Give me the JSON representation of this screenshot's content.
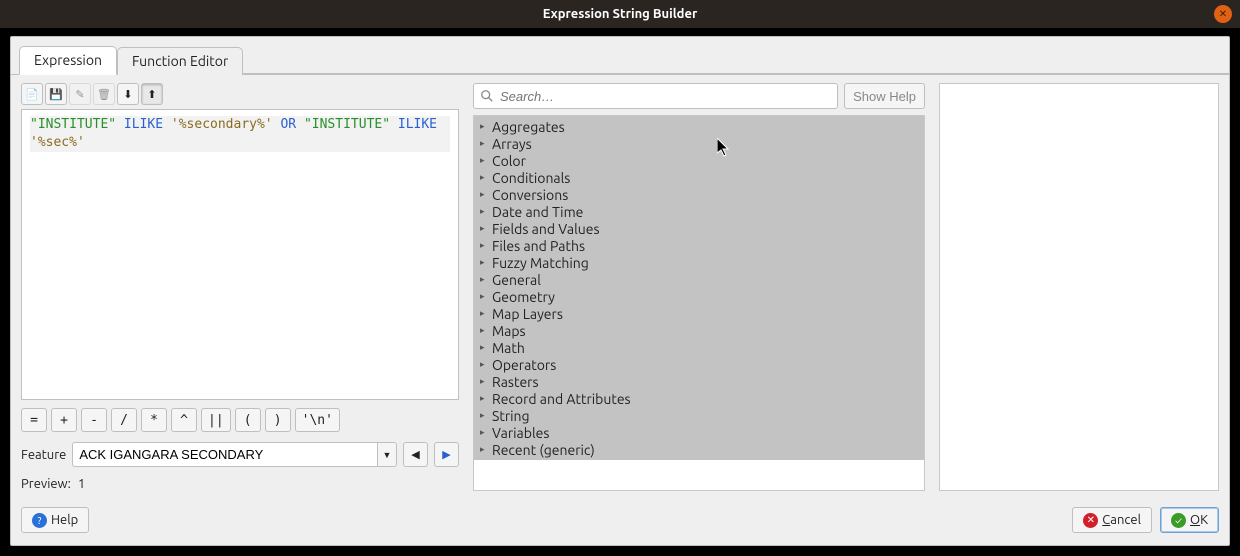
{
  "window": {
    "title": "Expression String Builder"
  },
  "tabs": {
    "expression": "Expression",
    "function_editor": "Function Editor"
  },
  "toolbar_icons": {
    "new": "📄",
    "save": "💾",
    "edit": "✎",
    "delete": "🗑",
    "import": "⬇",
    "export": "⬆"
  },
  "expression": {
    "tokens": {
      "field1": "\"INSTITUTE\"",
      "sp1": " ",
      "kw1": "ILIKE",
      "sp2": " ",
      "lit1": "'%secondary%'",
      "sp3": " ",
      "kw2": "OR",
      "sp4": " ",
      "field2": "\"INSTITUTE\"",
      "sp5": " ",
      "kw3": "ILIKE",
      "nl": "\n",
      "lit2": "'%sec%'"
    }
  },
  "operators": {
    "eq": "=",
    "plus": "+",
    "minus": "-",
    "div": "/",
    "mul": "*",
    "pow": "^",
    "concat": "||",
    "lparen": "(",
    "rparen": ")",
    "newline": "'\\n'"
  },
  "feature": {
    "label": "Feature",
    "value": "ACK IGANGARA SECONDARY"
  },
  "preview": {
    "label": "Preview:",
    "value": "1"
  },
  "search": {
    "placeholder": "Search…"
  },
  "buttons": {
    "show_help": "Show Help",
    "help": "Help",
    "cancel": "Cancel",
    "ok": "OK"
  },
  "categories": [
    "Aggregates",
    "Arrays",
    "Color",
    "Conditionals",
    "Conversions",
    "Date and Time",
    "Fields and Values",
    "Files and Paths",
    "Fuzzy Matching",
    "General",
    "Geometry",
    "Map Layers",
    "Maps",
    "Math",
    "Operators",
    "Rasters",
    "Record and Attributes",
    "String",
    "Variables",
    "Recent (generic)"
  ]
}
